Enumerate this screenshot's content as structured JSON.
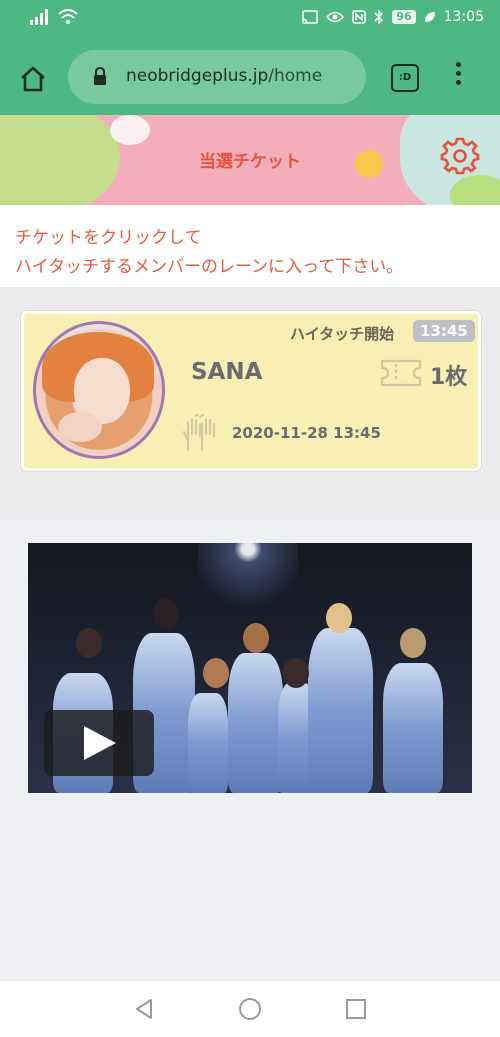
{
  "status_bar": {
    "battery": "96",
    "time": "13:05"
  },
  "browser": {
    "url_domain": "neobridgeplus.jp",
    "url_path": "/home",
    "tabs_label": ":D"
  },
  "banner": {
    "title": "当選チケット"
  },
  "instruction": {
    "line1": "チケットをクリックして",
    "line2": "ハイタッチするメンバーのレーンに入って下さい。"
  },
  "ticket": {
    "start_label": "ハイタッチ開始",
    "start_time": "13:45",
    "member_name": "SANA",
    "count": "1枚",
    "datetime": "2020-11-28 13:45"
  },
  "colors": {
    "brand_green": "#4db881",
    "accent_red": "#e7523a",
    "card_yellow": "#f7efb4",
    "avatar_border": "#a176b3"
  },
  "icons": [
    "home-icon",
    "lock-icon",
    "tabs-icon",
    "more-icon",
    "gear-icon",
    "ticket-icon",
    "high-five-icon",
    "play-icon",
    "back-icon",
    "home-nav-icon",
    "recent-apps-icon"
  ]
}
